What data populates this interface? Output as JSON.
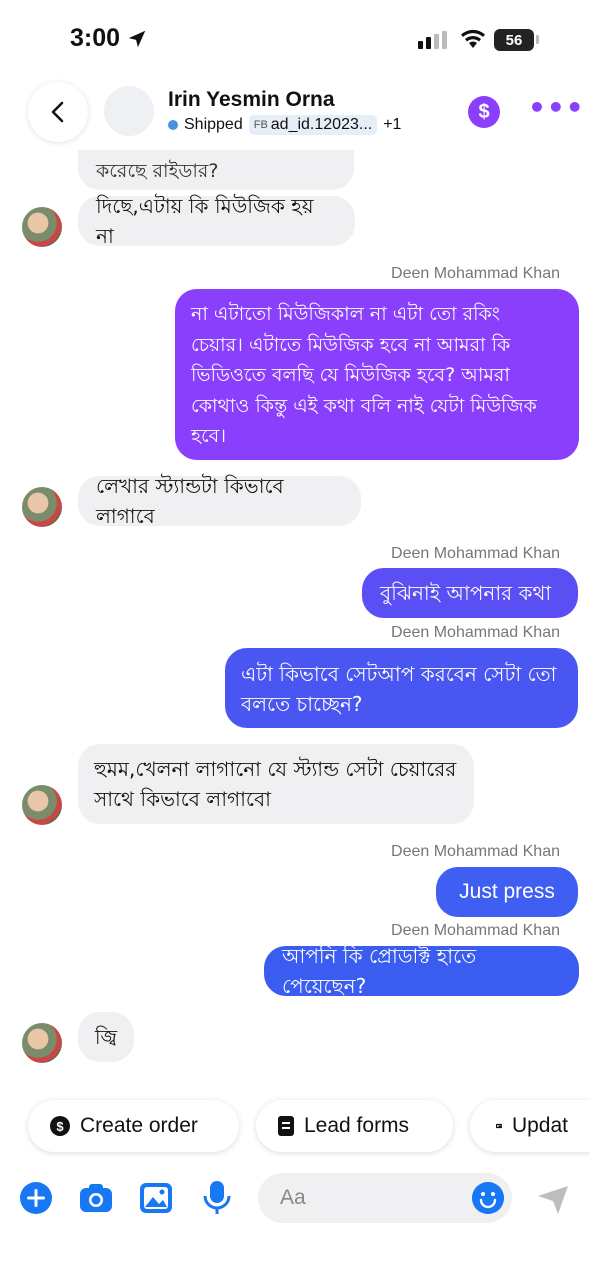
{
  "status_bar": {
    "time": "3:00",
    "battery": "56",
    "location_icon": "location-arrow-icon",
    "signal_icon": "signal-icon",
    "wifi_icon": "wifi-icon"
  },
  "header": {
    "back_icon": "chevron-left-icon",
    "name": "Irin Yesmin Orna",
    "status": "Shipped",
    "ad_tag": "ad_id.12023...",
    "ad_prefix": "FB",
    "extra_count": "+1",
    "payment_icon": "dollar-icon",
    "more_icon": "more-dots-icon",
    "accent": "#8a3ffc"
  },
  "messages": {
    "m0": "করেছে রাইডার?",
    "m1": "দিছে,এটায় কি মিউজিক হয় না",
    "s2": "Deen Mohammad Khan",
    "m2": [
      "না এটাতো মিউজিকাল না এটা তো রকিং",
      "চেয়ার। এটাতে মিউজিক হবে না আমরা কি",
      "ভিডিওতে বলছি যে মিউজিক হবে? আমরা",
      "কোথাও কিন্তু এই কথা বলি নাই যেটা মিউজিক",
      "হবে।"
    ],
    "m3": "লেখার স্ট্যান্ডটা কিভাবে লাগাবে",
    "s4": "Deen Mohammad Khan",
    "m4": "বুঝিনাই আপনার কথা",
    "s5": "Deen Mohammad Khan",
    "m5": [
      "এটা কিভাবে সেটআপ করবেন সেটা তো",
      "বলতে চাচ্ছেন?"
    ],
    "m6": [
      "হুমম,খেলনা লাগানো যে স্ট্যান্ড সেটা চেয়ারের",
      "সাথে কিভাবে লাগাবো"
    ],
    "s7": "Deen Mohammad Khan",
    "m7": "Just press",
    "s8": "Deen Mohammad Khan",
    "m8": "আপনি কি প্রোডাক্ট হাতে পেয়েছেন?",
    "m9": "জ্বি"
  },
  "quick_actions": {
    "create_order": "Create order",
    "lead_forms": "Lead forms",
    "update": "Updat"
  },
  "composer": {
    "placeholder": "Aa",
    "icons": [
      "plus-icon",
      "camera-icon",
      "image-icon",
      "microphone-icon",
      "emoji-icon",
      "send-icon"
    ]
  },
  "colors": {
    "outgoing_purple": "#8a3ffc",
    "outgoing_blue": "#3a5cf0",
    "incoming": "#f0f0f2",
    "tool_blue": "#1877f2"
  }
}
